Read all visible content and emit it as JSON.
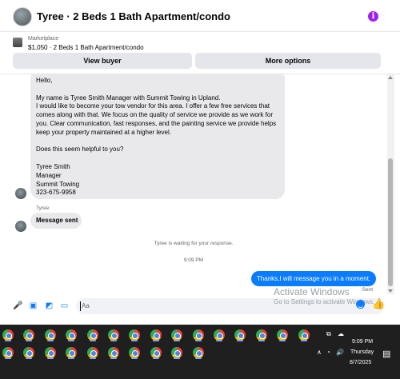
{
  "header": {
    "title": "Tyree · 2 Beds 1 Bath Apartment/condo",
    "info_icon": "info-icon",
    "info_glyph": "i"
  },
  "listing": {
    "label": "Marketplace",
    "price_title": "$1,050 · 2 Beds 1 Bath Apartment/condo",
    "view_buyer_label": "View buyer",
    "more_options_label": "More options"
  },
  "messages": {
    "long_message": {
      "greeting": "Hello,",
      "line1": "My name is Tyree Smith Manager with Summit Towing in Upland.",
      "line2": " I would like to become your tow vendor for this area. I offer a few free services that",
      "line3": "comes along with that. We focus on the quality of service we provide as we work for",
      "line4": "you. Clear communication, fast responses, and the painting service we provide helps",
      "line5": "keep your property maintained at a higher level.",
      "question": "Does this seem helpful to you?",
      "sig_name": "Tyree Smith",
      "sig_title": "Manager",
      "sig_company": "Summit Towing",
      "sig_phone": "323-675-9958"
    },
    "sender_name": "Tyree",
    "short_message": "Message sent",
    "waiting_text": "Tyree is waiting for your response.",
    "timestamp": "9:09 PM",
    "my_message": "Thanks,I will message you in a moment.",
    "my_status": "Sent"
  },
  "composer": {
    "placeholder": "Aa",
    "icons": [
      "microphone-icon",
      "photo-icon",
      "sticker-icon",
      "gif-icon",
      "emoji-icon",
      "like-icon"
    ],
    "mic_glyph": "🎤",
    "photo_glyph": "▣",
    "sticker_glyph": "◩",
    "gif_glyph": "▭",
    "like_glyph": "👍"
  },
  "watermark": {
    "line1": "Activate Windows",
    "line2": "Go to Settings to activate Windows."
  },
  "taskbar": {
    "app_icon": "chrome-icon",
    "time": "9:09 PM",
    "day": "Thursday",
    "date": "8/7/2025",
    "chevron_glyph": "∧",
    "network_glyph": "◔",
    "volume_glyph": "🔊",
    "notification_glyph": "▤",
    "tray_glyph1": "⧉",
    "tray_glyph2": "☁"
  },
  "colors": {
    "accent": "#0a7cff",
    "info": "#a020f0",
    "bubble_gray": "#e9e9eb",
    "taskbar": "#1f1f1f"
  }
}
